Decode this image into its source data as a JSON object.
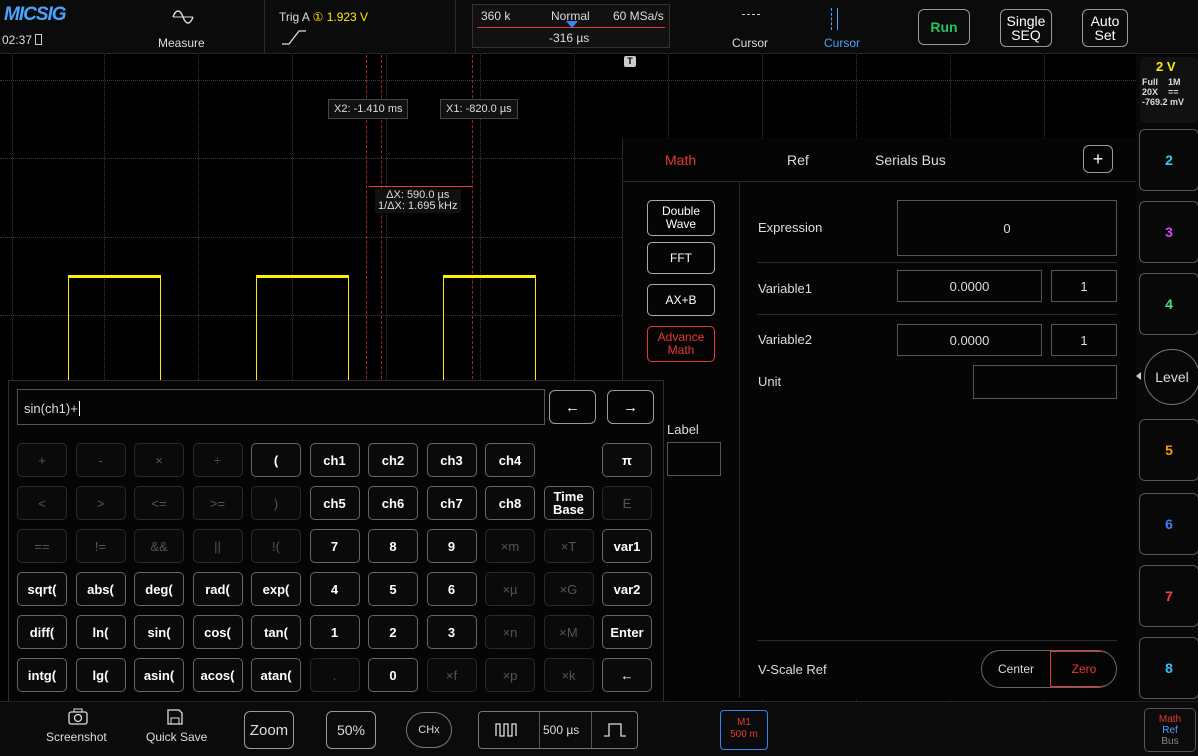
{
  "header": {
    "logo": "MICSIG",
    "time": "02:37",
    "measure_label": "Measure",
    "trigger_label": "Trig A",
    "trigger_channel": "①",
    "trigger_level": "1.923 V",
    "memory_depth": "360 k",
    "acq_mode": "Normal",
    "sample_rate": "60 MSa/s",
    "time_offset": "-316 µs",
    "cursor1_label": "Cursor",
    "cursor2_label": "Cursor",
    "run_label": "Run",
    "single_label_1": "Single",
    "single_label_2": "SEQ",
    "auto_label_1": "Auto",
    "auto_label_2": "Set"
  },
  "scope": {
    "cursor_x2": "X2: -1.410 ms",
    "cursor_x1": "X1: -820.0 µs",
    "delta_x": "ΔX: 590.0 µs",
    "inv_delta_x": "1/ΔX: 1.695 kHz",
    "trigger_marker": "T"
  },
  "math_panel": {
    "tabs": [
      "Math",
      "Ref",
      "Serials Bus"
    ],
    "add_label": "+",
    "side_buttons": [
      {
        "l1": "Double",
        "l2": "Wave"
      },
      {
        "l1": "FFT",
        "l2": ""
      },
      {
        "l1": "AX+B",
        "l2": ""
      },
      {
        "l1": "Advance",
        "l2": "Math"
      }
    ],
    "expression_label": "Expression",
    "expression_value": "0",
    "variable1_label": "Variable1",
    "variable1_value": "0.0000",
    "variable1_unit": "1",
    "variable2_label": "Variable2",
    "variable2_value": "0.0000",
    "variable2_unit": "1",
    "unit_label": "Unit",
    "label_label": "Label",
    "vscale_label": "V-Scale Ref",
    "vscale_center": "Center",
    "vscale_zero": "Zero"
  },
  "keyboard": {
    "input_value": "sin(ch1)+",
    "left_arrow": "←",
    "right_arrow": "→",
    "rows": [
      [
        "+",
        "-",
        "×",
        "÷",
        "(",
        "ch1",
        "ch2",
        "ch3",
        "ch4",
        "",
        "π"
      ],
      [
        "<",
        ">",
        "<=",
        ">=",
        ")",
        "ch5",
        "ch6",
        "ch7",
        "ch8",
        "Time Base",
        "E"
      ],
      [
        "==",
        "!=",
        "&&",
        "||",
        "!(",
        "7",
        "8",
        "9",
        "×m",
        "×T",
        "var1"
      ],
      [
        "sqrt(",
        "abs(",
        "deg(",
        "rad(",
        "exp(",
        "4",
        "5",
        "6",
        "×µ",
        "×G",
        "var2"
      ],
      [
        "diff(",
        "ln(",
        "sin(",
        "cos(",
        "tan(",
        "1",
        "2",
        "3",
        "×n",
        "×M",
        "Enter"
      ],
      [
        "intg(",
        "lg(",
        "asin(",
        "acos(",
        "atan(",
        ".",
        "0",
        "×f",
        "×p",
        "×k",
        "←"
      ]
    ]
  },
  "right_column": {
    "ch1_scale": "2 V",
    "ch1_bw": "Full",
    "ch1_imp": "1M",
    "ch1_probe": "20X",
    "ch1_coupling": "==",
    "ch1_offset": "-769.2 mV",
    "channels": [
      "2",
      "3",
      "4",
      "5",
      "6",
      "7",
      "8"
    ],
    "level_label": "Level",
    "mrb_math": "Math",
    "mrb_ref": "Ref",
    "mrb_bus": "Bus"
  },
  "bottom": {
    "screenshot_label": "Screenshot",
    "quicksave_label": "Quick Save",
    "zoom_label": "Zoom",
    "percent_label": "50%",
    "chx_label": "CHx",
    "timebase": "500 µs",
    "m1_label": "M1",
    "m1_scale": "500 m"
  },
  "colors": {
    "ch1": "#ffea00",
    "ch2": "#22d3ee",
    "ch3": "#e040fb",
    "ch4": "#4ade80",
    "ch5": "#f59e0b",
    "ch6": "#3b82f6",
    "ch7": "#ef4444",
    "ch8": "#38bdf8",
    "math": "#e53935",
    "run": "#22c55e"
  }
}
